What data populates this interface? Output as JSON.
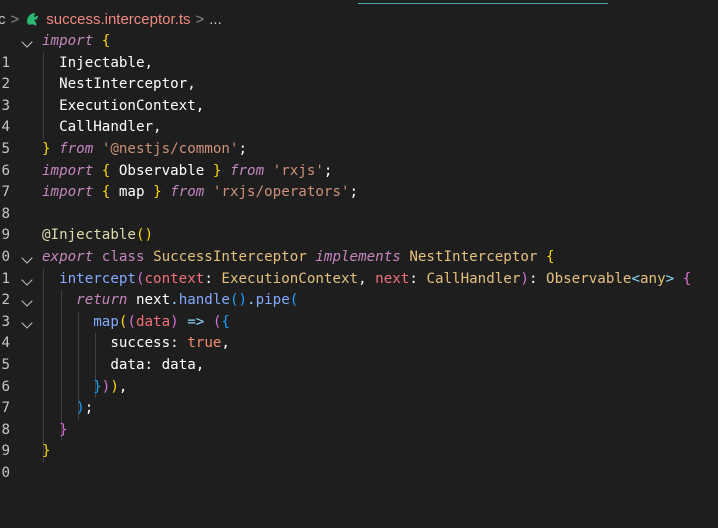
{
  "breadcrumb": {
    "folder_fragment": "c",
    "separator": ">",
    "file_name": "success.interceptor.ts",
    "more": "..."
  },
  "line_numbers": [
    "1",
    "2",
    "3",
    "4",
    "5",
    "6",
    "7",
    "8",
    "9",
    "0",
    "1",
    "2",
    "3",
    "4",
    "5",
    "6",
    "7",
    "8",
    "9",
    "0"
  ],
  "code": {
    "l1_import": "import",
    "l1_brace": "{",
    "l2": "Injectable,",
    "l3": "NestInterceptor,",
    "l4": "ExecutionContext,",
    "l5": "CallHandler,",
    "l6_brace": "}",
    "l6_from": "from",
    "l6_str": "'@nestjs/common'",
    "l6_semi": ";",
    "l7_import": "import",
    "l7_ob": "{",
    "l7_id": "Observable",
    "l7_cb": "}",
    "l7_from": "from",
    "l7_str": "'rxjs'",
    "l7_semi": ";",
    "l8_import": "import",
    "l8_ob": "{",
    "l8_id": "map",
    "l8_cb": "}",
    "l8_from": "from",
    "l8_str": "'rxjs/operators'",
    "l8_semi": ";",
    "l10_dec": "@Injectable",
    "l10_parens": "()",
    "l11_export": "export",
    "l11_class": "class",
    "l11_name": "SuccessInterceptor",
    "l11_impl": "implements",
    "l11_iface": "NestInterceptor",
    "l11_brace": "{",
    "l12_fn": "intercept",
    "l12_op": "(",
    "l12_p1": "context",
    "l12_colon1": ":",
    "l12_t1": "ExecutionContext",
    "l12_comma": ",",
    "l12_p2": "next",
    "l12_colon2": ":",
    "l12_t2": "CallHandler",
    "l12_cp": ")",
    "l12_colon3": ":",
    "l12_t3": "Observable",
    "l12_lt": "<",
    "l12_any": "any",
    "l12_gt": ">",
    "l12_brace": "{",
    "l13_return": "return",
    "l13_next": "next",
    "l13_dot1": ".",
    "l13_handle": "handle",
    "l13_parens": "()",
    "l13_dot2": ".",
    "l13_pipe": "pipe",
    "l13_op": "(",
    "l14_map": "map",
    "l14_op1": "(",
    "l14_op2": "(",
    "l14_data": "data",
    "l14_cp": ")",
    "l14_arrow": "=>",
    "l14_op3": "(",
    "l14_brace": "{",
    "l15_key": "success",
    "l15_colon": ":",
    "l15_val": "true",
    "l15_comma": ",",
    "l16_key": "data",
    "l16_colon": ":",
    "l16_val": "data",
    "l16_comma": ",",
    "l17_cb": "}",
    "l17_cp1": ")",
    "l17_cp2": ")",
    "l17_comma": ",",
    "l18_cp": ")",
    "l18_semi": ";",
    "l19_cb": "}",
    "l20_cb": "}"
  }
}
